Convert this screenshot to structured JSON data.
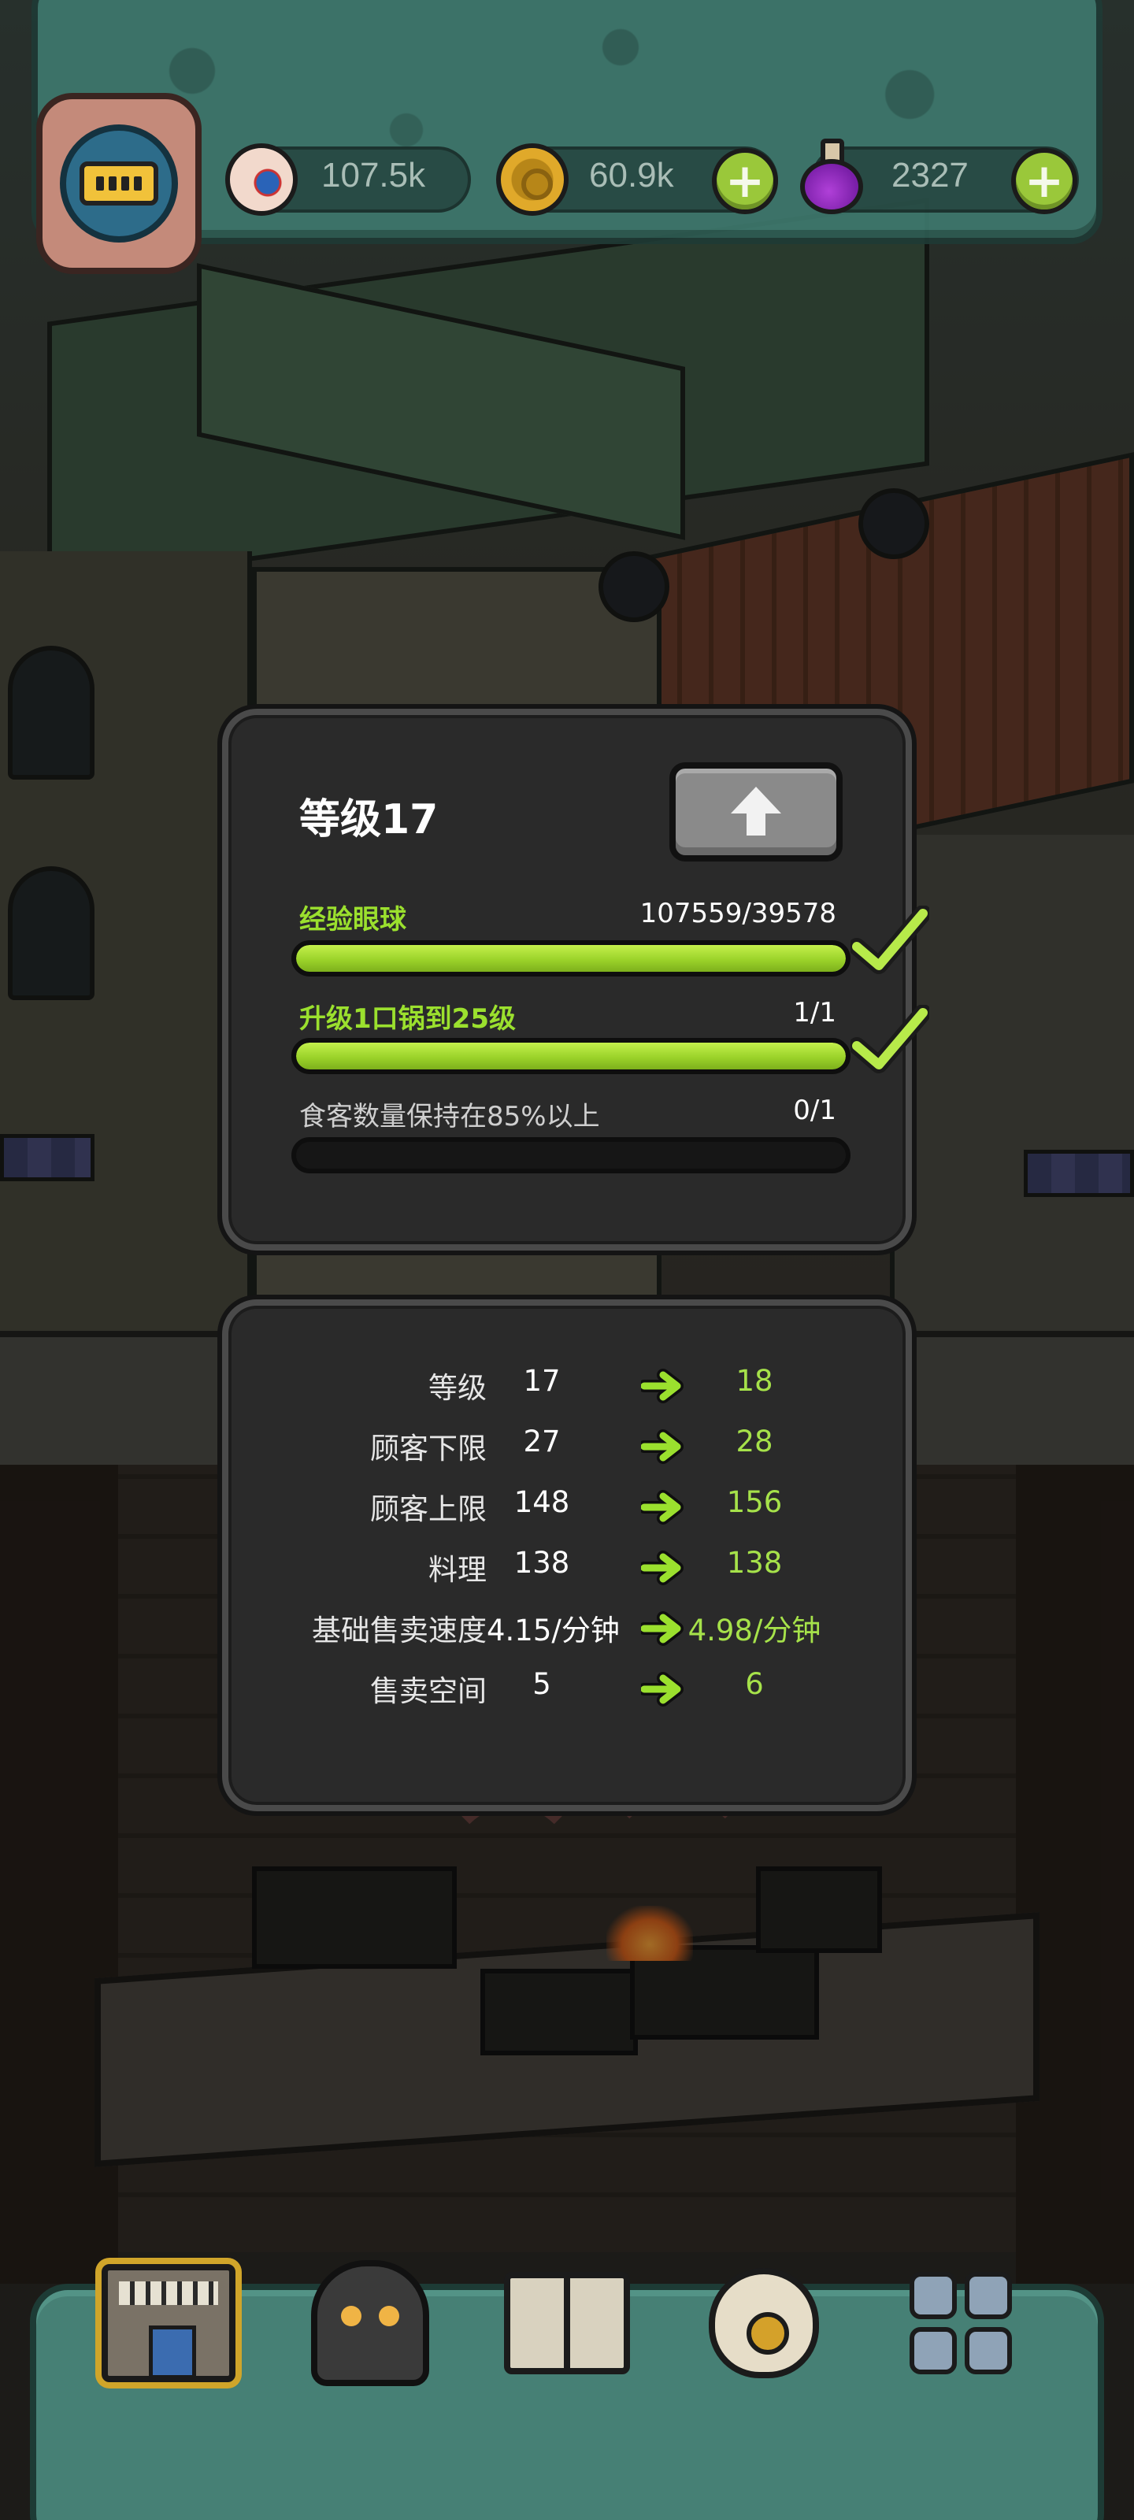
{
  "resources": {
    "eyeballs": "107.5k",
    "coins": "60.9k",
    "potions": "2327"
  },
  "level_panel": {
    "title": "等级17",
    "tasks": [
      {
        "label": "经验眼球",
        "progress": "107559/39578",
        "fill": 1.0,
        "done": true,
        "label_color": "#9be02e"
      },
      {
        "label": "升级1口锅到25级",
        "progress": "1/1",
        "fill": 1.0,
        "done": true,
        "label_color": "#9be02e"
      },
      {
        "label": "食客数量保持在85%以上",
        "progress": "0/1",
        "fill": 0.0,
        "done": false,
        "label_color": "#cfcfcf"
      }
    ]
  },
  "stats": [
    {
      "label": "等级",
      "current": "17",
      "next": "18"
    },
    {
      "label": "顾客下限",
      "current": "27",
      "next": "28"
    },
    {
      "label": "顾客上限",
      "current": "148",
      "next": "156"
    },
    {
      "label": "料理",
      "current": "138",
      "next": "138"
    },
    {
      "label": "基础售卖速度",
      "current": "4.15/分钟",
      "next": "4.98/分钟"
    },
    {
      "label": "售卖空间",
      "current": "5",
      "next": "6"
    }
  ],
  "icons": {
    "upgrade": "arrow-up-icon",
    "eyeball": "eyeball-icon",
    "coin": "coin-icon",
    "potion": "potion-icon",
    "plus": "plus-icon",
    "check": "checkmark-icon",
    "stat_arrow": "arrow-right-icon"
  },
  "colors": {
    "accent_green": "#a6e24a",
    "panel_bg": "#2a2a2a",
    "teal_frame": "#3f7a6f"
  }
}
